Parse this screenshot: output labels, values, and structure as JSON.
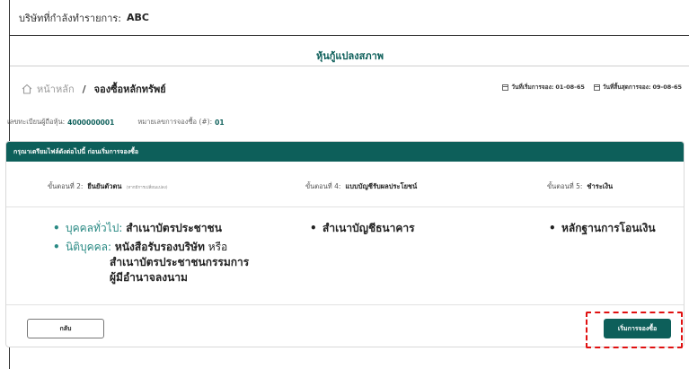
{
  "company_bar": {
    "label": "บริษัทที่กำลังทำรายการ:",
    "company_name": "ABC"
  },
  "page_header": {
    "title": "หุ้นกู้แปลงสภาพ"
  },
  "breadcrumb": {
    "home_label": "หน้าหลัก",
    "separator": "/",
    "current_label": "จองซื้อหลักทรัพย์"
  },
  "dates": {
    "start_label": "วันที่เริ่มการจอง:",
    "start_value": "01-08-65",
    "end_label": "วันที่สิ้นสุดการจอง:",
    "end_value": "09-08-65"
  },
  "registration": {
    "holder_label": "เลขทะเบียนผู้ถือหุ้น:",
    "holder_value": "4000000001",
    "booking_label": "หมายเลขการจองซื้อ (#):",
    "booking_value": "01"
  },
  "card": {
    "header": "กรุณาเตรียมไฟล์ดังต่อไปนี้ ก่อนเริ่มการจองซื้อ",
    "steps": [
      {
        "prefix": "ขั้นตอนที่ 2:",
        "title": "ยืนยันตัวตน",
        "note": "(หากมีการเปลี่ยนแปลง)"
      },
      {
        "prefix": "ขั้นตอนที่ 4:",
        "title": "แบบบัญชีรับผลประโยชน์",
        "note": ""
      },
      {
        "prefix": "ขั้นตอนที่ 5:",
        "title": "ชำระเงิน",
        "note": ""
      }
    ],
    "col1": {
      "item1_label": "บุคคลทั่วไป:",
      "item1_value": "สำเนาบัตรประชาชน",
      "item2_label": "นิติบุคคล:",
      "item2_value": "หนังสือรับรองบริษัท",
      "item2_conj": "หรือ",
      "item2_line2": "สำเนาบัตรประชาชนกรรมการ",
      "item2_line3": "ผู้มีอำนาจลงนาม"
    },
    "col2": {
      "item1": "สำเนาบัญชีธนาคาร"
    },
    "col3": {
      "item1": "หลักฐานการโอนเงิน"
    }
  },
  "buttons": {
    "back_label": "กลับ",
    "start_label": "เริ่มการจองซื้อ"
  },
  "colors": {
    "accent": "#0d5f5a",
    "highlight": "#e01010"
  },
  "icons": {
    "home": "home-icon",
    "calendar": "calendar-icon"
  }
}
